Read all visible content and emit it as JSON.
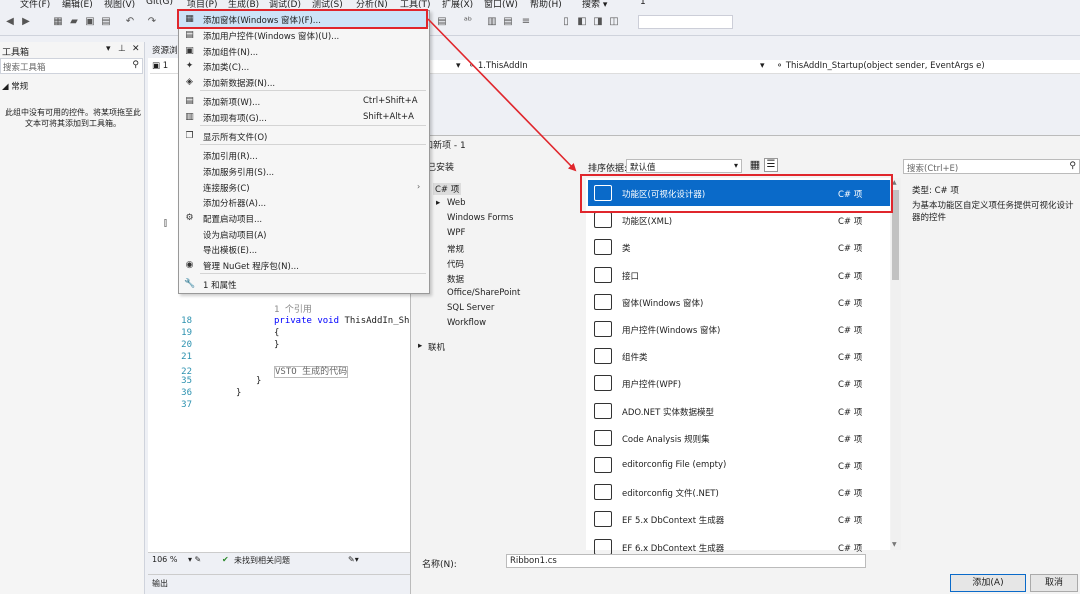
{
  "menubar": {
    "items": [
      "文件(F)",
      "编辑(E)",
      "视图(V)",
      "Git(G)",
      "项目(P)",
      "生成(B)",
      "调试(D)",
      "测试(S)",
      "分析(N)",
      "工具(T)",
      "扩展(X)",
      "窗口(W)",
      "帮助(H)",
      "搜索 ▾",
      "1"
    ]
  },
  "toolbox": {
    "title": "工具箱",
    "search_placeholder": "搜索工具箱",
    "group": "常规",
    "empty_message": "此组中没有可用的控件。将某项拖至此文本可将其添加到工具箱。"
  },
  "editor": {
    "tab": "资源浏",
    "doc_tab": "1",
    "nav_class": "1.ThisAddIn",
    "nav_method": "ThisAddIn_Startup(object sender, EventArgs e)",
    "lines": [
      {
        "num": "",
        "text": "1 个引用",
        "type": "ref"
      },
      {
        "num": "18",
        "text": "private void ThisAddIn_Shutd",
        "type": "code"
      },
      {
        "num": "19",
        "text": "{",
        "type": "code"
      },
      {
        "num": "20",
        "text": "}",
        "type": "code"
      },
      {
        "num": "21",
        "text": "",
        "type": "code"
      },
      {
        "num": "22",
        "text": "VSTO 生成的代码",
        "type": "region"
      },
      {
        "num": "35",
        "text": "}",
        "type": "code"
      },
      {
        "num": "36",
        "text": "}",
        "type": "code"
      },
      {
        "num": "37",
        "text": "",
        "type": "code"
      }
    ],
    "zoom": "106 %",
    "status": "未找到相关问题",
    "output": "输出"
  },
  "dropdown": {
    "items": [
      {
        "icon": "▦",
        "label": "添加窗体(Windows 窗体)(F)...",
        "shortcut": "",
        "arrow": false
      },
      {
        "icon": "▤",
        "label": "添加用户控件(Windows 窗体)(U)...",
        "shortcut": "",
        "arrow": false
      },
      {
        "icon": "▣",
        "label": "添加组件(N)...",
        "shortcut": "",
        "arrow": false
      },
      {
        "icon": "✦",
        "label": "添加类(C)...",
        "shortcut": "",
        "arrow": false
      },
      {
        "icon": "◈",
        "label": "添加新数据源(N)...",
        "shortcut": "",
        "arrow": false
      },
      {
        "icon": "▤",
        "label": "添加新项(W)...",
        "shortcut": "Ctrl+Shift+A",
        "arrow": false
      },
      {
        "icon": "▥",
        "label": "添加现有项(G)...",
        "shortcut": "Shift+Alt+A",
        "arrow": false
      },
      {
        "icon": "❐",
        "label": "显示所有文件(O)",
        "shortcut": "",
        "arrow": false
      },
      {
        "icon": "",
        "label": "添加引用(R)...",
        "shortcut": "",
        "arrow": false
      },
      {
        "icon": "",
        "label": "添加服务引用(S)...",
        "shortcut": "",
        "arrow": false
      },
      {
        "icon": "",
        "label": "连接服务(C)",
        "shortcut": "",
        "arrow": true
      },
      {
        "icon": "",
        "label": "添加分析器(A)...",
        "shortcut": "",
        "arrow": false
      },
      {
        "icon": "⚙",
        "label": "配置启动项目...",
        "shortcut": "",
        "arrow": false
      },
      {
        "icon": "",
        "label": "设为启动项目(A)",
        "shortcut": "",
        "arrow": false
      },
      {
        "icon": "",
        "label": "导出模板(E)...",
        "shortcut": "",
        "arrow": false
      },
      {
        "icon": "◉",
        "label": "管理 NuGet 程序包(N)...",
        "shortcut": "",
        "arrow": false
      },
      {
        "icon": "🔧",
        "label": "1 和属性",
        "shortcut": "",
        "arrow": false
      }
    ]
  },
  "dialog": {
    "title": "加新项 - 1",
    "installed": "已安装",
    "tree": [
      "C# 项",
      "Web",
      "Windows Forms",
      "WPF",
      "常规",
      "代码",
      "数据",
      "Office/SharePoint",
      "SQL Server",
      "Workflow",
      "联机"
    ],
    "sort_label": "排序依据:",
    "sort_value": "默认值",
    "search_placeholder": "搜索(Ctrl+E)",
    "templates": [
      {
        "name": "功能区(可视化设计器)",
        "lang": "C# 项"
      },
      {
        "name": "功能区(XML)",
        "lang": "C# 项"
      },
      {
        "name": "类",
        "lang": "C# 项"
      },
      {
        "name": "接口",
        "lang": "C# 项"
      },
      {
        "name": "窗体(Windows 窗体)",
        "lang": "C# 项"
      },
      {
        "name": "用户控件(Windows 窗体)",
        "lang": "C# 项"
      },
      {
        "name": "组件类",
        "lang": "C# 项"
      },
      {
        "name": "用户控件(WPF)",
        "lang": "C# 项"
      },
      {
        "name": "ADO.NET 实体数据模型",
        "lang": "C# 项"
      },
      {
        "name": "Code Analysis 规则集",
        "lang": "C# 项"
      },
      {
        "name": "editorconfig File (empty)",
        "lang": "C# 项"
      },
      {
        "name": "editorconfig 文件(.NET)",
        "lang": "C# 项"
      },
      {
        "name": "EF 5.x DbContext 生成器",
        "lang": "C# 项"
      },
      {
        "name": "EF 6.x DbContext 生成器",
        "lang": "C# 项"
      }
    ],
    "detail_type_label": "类型:",
    "detail_type_value": "C# 项",
    "detail_desc": "为基本功能区自定义项任务提供可视化设计器的控件",
    "name_label": "名称(N):",
    "name_value": "Ribbon1.cs",
    "add_button": "添加(A)",
    "cancel_button": "取消"
  },
  "colors": {
    "accent": "#0a6ac9",
    "annotation": "#e0262c"
  }
}
